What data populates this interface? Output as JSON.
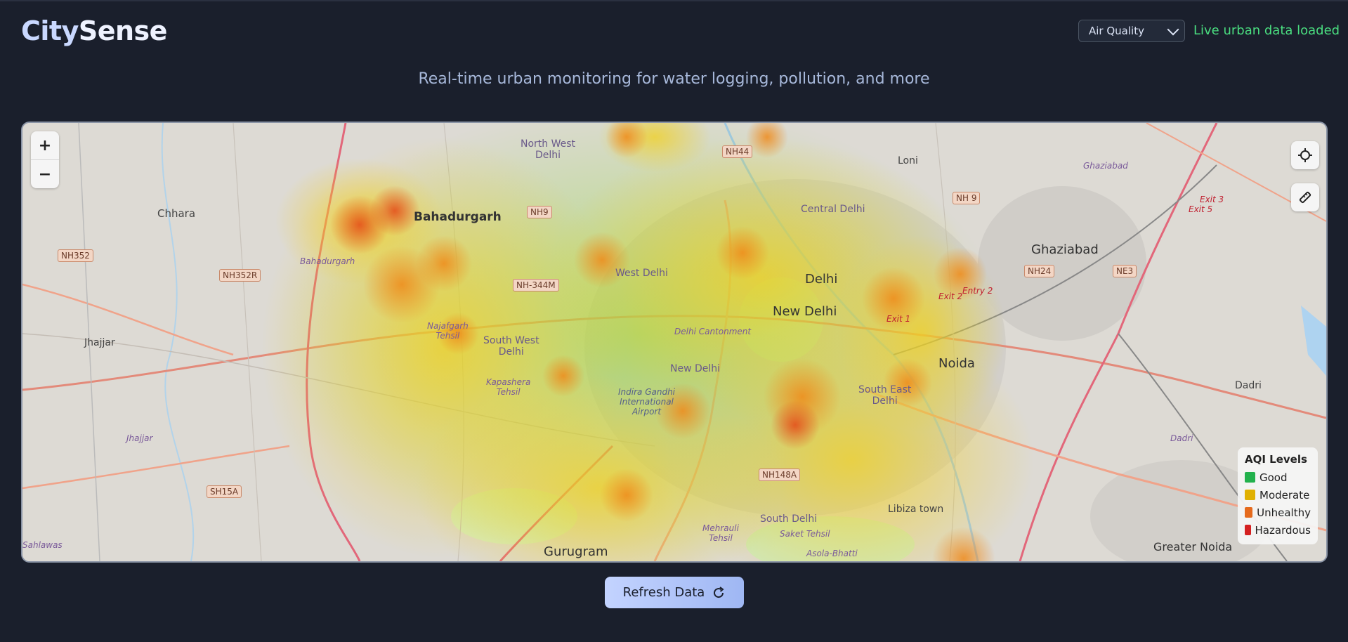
{
  "app": {
    "logo_part1": "City",
    "logo_part2": "Sense",
    "subtitle": "Real-time urban monitoring for water logging, pollution, and more"
  },
  "header": {
    "layer_select_value": "Air Quality",
    "status_text": "Live urban data loaded",
    "status_color": "#4ade80"
  },
  "map": {
    "zoom_in_label": "+",
    "zoom_out_label": "−",
    "places": {
      "north_west_delhi": "North West\nDelhi",
      "chhara": "Chhara",
      "bahadurgarh": "Bahadurgarh",
      "bahadurgarh_small": "Bahadurgarh",
      "jhajjar": "Jhajjar",
      "jhajjar_small": "Jhajjar",
      "west_delhi": "West Delhi",
      "delhi": "Delhi",
      "central_delhi": "Central Delhi",
      "new_delhi": "New Delhi",
      "new_delhi_small": "New Delhi",
      "najafgarh": "Najafgarh\nTehsil",
      "south_west_delhi": "South West\nDelhi",
      "delhi_cantonment": "Delhi Cantonment",
      "kapashera": "Kapashera\nTehsil",
      "igi_airport": "Indira Gandhi\nInternational\nAirport",
      "south_east_delhi": "South East\nDelhi",
      "noida": "Noida",
      "ghaziabad": "Ghaziabad",
      "ghaziabad_small": "Ghaziabad",
      "loni": "Loni",
      "dadri": "Dadri",
      "dadri_small": "Dadri",
      "greater_noida": "Greater Noida",
      "gurugram": "Gurugram",
      "south_delhi": "South Delhi",
      "saket": "Saket Tehsil",
      "mehrauli": "Mehrauli\nTehsil",
      "libiza_town": "Libiza town",
      "asola": "Asola-Bhatti",
      "sahlawas": "Sahlawas",
      "exit1": "Exit 1",
      "exit2": "Exit 2",
      "entry2": "Entry 2",
      "exit3": "Exit 3",
      "exit5": "Exit 5"
    },
    "roads": {
      "nh352": "NH352",
      "nh352r": "NH352R",
      "nh9_west": "NH9",
      "nh44": "NH44",
      "nh9_east": "NH 9",
      "nh344m": "NH-344M",
      "nh24": "NH24",
      "ne3": "NE3",
      "nh148a": "NH148A",
      "sh15a": "SH15A"
    }
  },
  "legend": {
    "title": "AQI Levels",
    "items": [
      {
        "label": "Good",
        "color": "#22b14c"
      },
      {
        "label": "Moderate",
        "color": "#e0b000"
      },
      {
        "label": "Unhealthy",
        "color": "#e56a1c"
      },
      {
        "label": "Hazardous",
        "color": "#d42020"
      }
    ]
  },
  "actions": {
    "refresh_label": "Refresh Data"
  }
}
